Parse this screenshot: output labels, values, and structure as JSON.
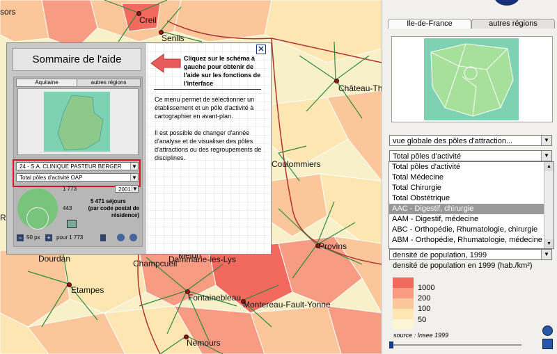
{
  "map": {
    "cities": [
      {
        "name": "sors"
      },
      {
        "name": "Creil"
      },
      {
        "name": "Senlis"
      },
      {
        "name": "Château-Th"
      },
      {
        "name": "Coulommiers"
      },
      {
        "name": "Provins"
      },
      {
        "name": "Dourdan"
      },
      {
        "name": "Champcueil"
      },
      {
        "name": "Melun"
      },
      {
        "name": "Dammarie-les-Lys"
      },
      {
        "name": "Etampes"
      },
      {
        "name": "Fontainebleau"
      },
      {
        "name": "Montereau-Fault-Yonne"
      },
      {
        "name": "Nemours"
      },
      {
        "name": "Ra"
      }
    ]
  },
  "help": {
    "title": "Sommaire de l'aide",
    "close_icon": "close-icon",
    "arrow_text": "Cliquez sur le schéma à gauche pour obtenir de l'aide sur les fonctions de l'interface",
    "para1": "Ce menu permet de sélectionner un établissement et un pôle d'activité à cartographier en avant-plan.",
    "para2": "Il est possible de changer d'année d'analyse et de visualiser des pôles d'attractions ou des regroupements de disciplines.",
    "mini": {
      "tab_active": "Aquitaine",
      "tab_other": "autres régions",
      "select_establishment": "24 - S.A. CLINIQUE PASTEUR  BERGER",
      "select_pole": "Total pôles d'activité OAP",
      "count_top": "1 773",
      "year": "2001",
      "count_mid": "443",
      "stays": "5 471  séjours",
      "stays_note": "(par code postal de résidence)",
      "px": "50 px",
      "per": "pour 1 773"
    }
  },
  "panel": {
    "tab_active": "Ile-de-France",
    "tab_other": "autres régions",
    "view_select": "vue globale des pôles d'attraction...",
    "pole_select": "Total pôles d'activité",
    "list": [
      "Total pôles d'activité",
      "Total Médecine",
      "Total Chirurgie",
      "Total Obstétrique",
      "AAC - Digestif, chirurgie",
      "AAM - Digestif, médecine",
      "ABC - Orthopédie, Rhumatologie, chirurgie",
      "ABM - Orthopédie, Rhumatologie, médecine"
    ],
    "selected_index": 4,
    "density_select": "densité de population, 1999",
    "legend_title": "densité de population en 1999 (hab./km²)",
    "legend": [
      {
        "label": "1000",
        "color": "#f26a5e"
      },
      {
        "label": "200",
        "color": "#f79b83"
      },
      {
        "label": "100",
        "color": "#fbc79a"
      },
      {
        "label": "50",
        "color": "#fde6b2"
      },
      {
        "label": "",
        "color": "#fdf6d6"
      }
    ],
    "source": "source : Insee 1999"
  }
}
